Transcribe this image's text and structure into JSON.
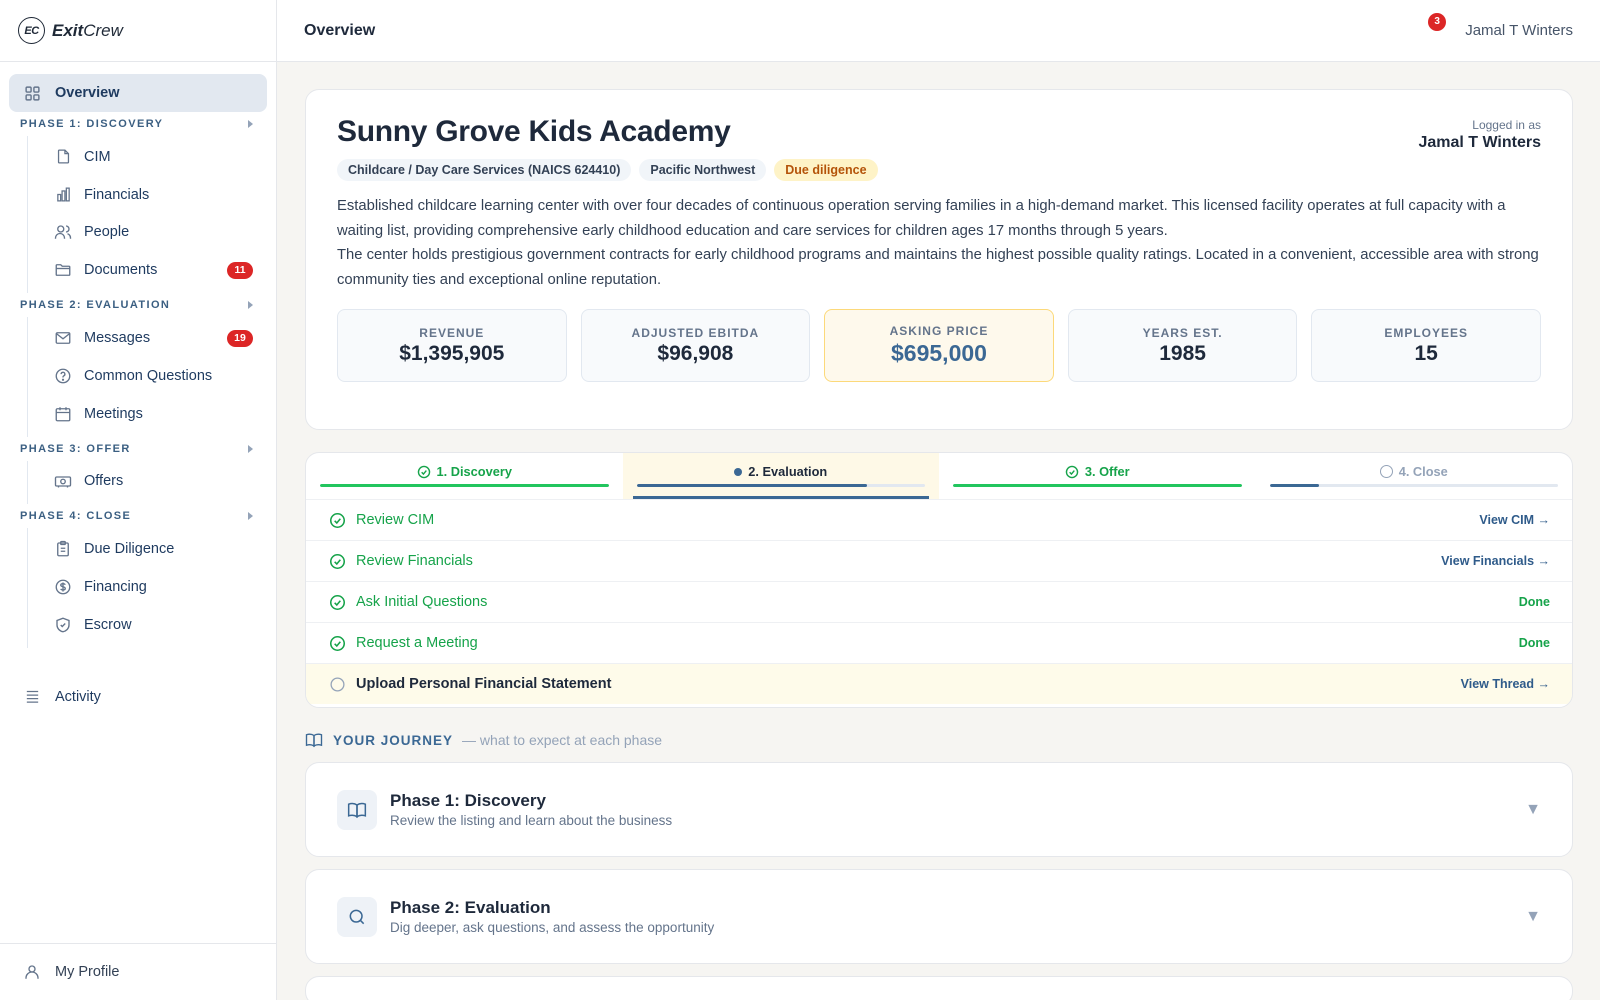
{
  "brand": {
    "logo": "EC",
    "name_bold": "Exit",
    "name_rest": "Crew"
  },
  "sidebar": {
    "overview": "Overview",
    "phases": [
      {
        "title": "PHASE 1: DISCOVERY",
        "items": [
          {
            "label": "CIM",
            "icon": "document-icon"
          },
          {
            "label": "Financials",
            "icon": "bar-chart-icon"
          },
          {
            "label": "People",
            "icon": "people-icon"
          },
          {
            "label": "Documents",
            "icon": "folder-icon",
            "badge": "11"
          }
        ]
      },
      {
        "title": "PHASE 2: EVALUATION",
        "items": [
          {
            "label": "Messages",
            "icon": "mail-icon",
            "badge": "19"
          },
          {
            "label": "Common Questions",
            "icon": "question-icon"
          },
          {
            "label": "Meetings",
            "icon": "calendar-icon"
          }
        ]
      },
      {
        "title": "PHASE 3: OFFER",
        "items": [
          {
            "label": "Offers",
            "icon": "cash-icon"
          }
        ]
      },
      {
        "title": "PHASE 4: CLOSE",
        "items": [
          {
            "label": "Due Diligence",
            "icon": "clipboard-icon"
          },
          {
            "label": "Financing",
            "icon": "dollar-icon"
          },
          {
            "label": "Escrow",
            "icon": "shield-icon"
          }
        ]
      }
    ],
    "activity": "Activity",
    "profile": "My Profile"
  },
  "header": {
    "title": "Overview",
    "notifications": "3",
    "user": "Jamal T Winters"
  },
  "business": {
    "name": "Sunny Grove Kids Academy",
    "logged_in_label": "Logged in as",
    "logged_in_user": "Jamal T Winters",
    "tags": [
      "Childcare / Day Care Services (NAICS 624410)",
      "Pacific Northwest",
      "Due diligence"
    ],
    "desc1": "Established childcare learning center with over four decades of continuous operation serving families in a high-demand market. This licensed facility operates at full capacity with a waiting list, providing comprehensive early childhood education and care services for children ages 17 months through 5 years.",
    "desc2": "The center holds prestigious government contracts for early childhood programs and maintains the highest possible quality ratings. Located in a convenient, accessible area with strong community ties and exceptional online reputation.",
    "stats": [
      {
        "label": "REVENUE",
        "value": "$1,395,905"
      },
      {
        "label": "ADJUSTED EBITDA",
        "value": "$96,908"
      },
      {
        "label": "ASKING PRICE",
        "value": "$695,000"
      },
      {
        "label": "YEARS EST.",
        "value": "1985"
      },
      {
        "label": "EMPLOYEES",
        "value": "15"
      }
    ]
  },
  "progress": {
    "steps": [
      {
        "label": "1. Discovery",
        "state": "done",
        "fill": 100
      },
      {
        "label": "2. Evaluation",
        "state": "current",
        "fill": 80
      },
      {
        "label": "3. Offer",
        "state": "done",
        "fill": 100
      },
      {
        "label": "4. Close",
        "state": "future",
        "fill": 17
      }
    ],
    "tasks": [
      {
        "label": "Review CIM",
        "action": "View CIM →",
        "state": "done"
      },
      {
        "label": "Review Financials",
        "action": "View Financials →",
        "state": "done"
      },
      {
        "label": "Ask Initial Questions",
        "action": "Done",
        "state": "done"
      },
      {
        "label": "Request a Meeting",
        "action": "Done",
        "state": "done"
      },
      {
        "label": "Upload Personal Financial Statement",
        "action": "View Thread →",
        "state": "pending"
      }
    ]
  },
  "journey": {
    "title": "YOUR JOURNEY",
    "subtitle": "— what to expect at each phase",
    "phases": [
      {
        "name": "Phase 1: Discovery",
        "desc": "Review the listing and learn about the business"
      },
      {
        "name": "Phase 2: Evaluation",
        "desc": "Dig deeper, ask questions, and assess the opportunity"
      }
    ]
  },
  "colors": {
    "accent": "#3b6894",
    "success": "#16a34a",
    "danger": "#dc2626",
    "warning_bg": "#fef3c7"
  }
}
